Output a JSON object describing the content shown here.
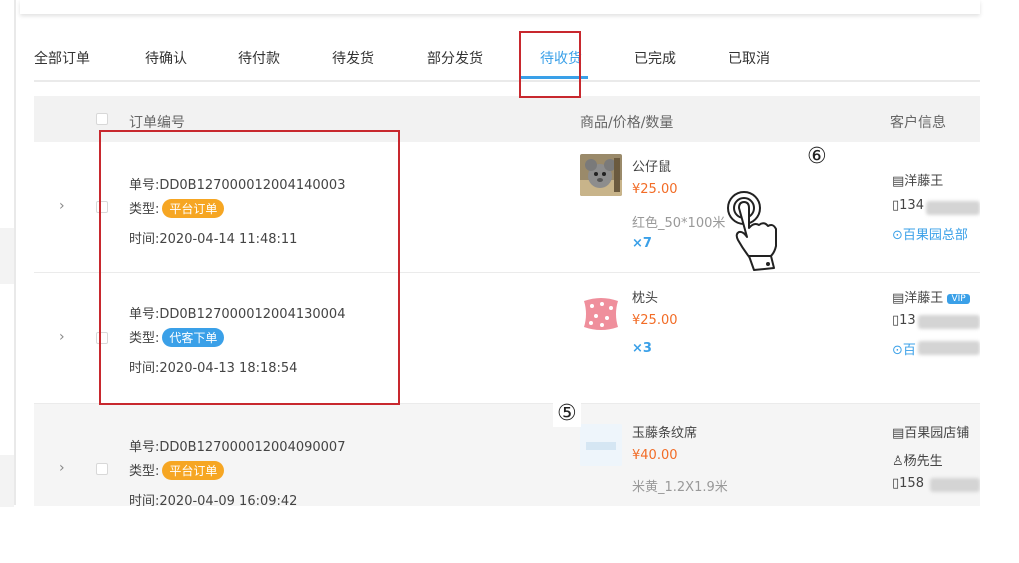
{
  "tabs": [
    {
      "label": "全部订单"
    },
    {
      "label": "待确认"
    },
    {
      "label": "待付款"
    },
    {
      "label": "待发货"
    },
    {
      "label": "部分发货"
    },
    {
      "label": "待收货"
    },
    {
      "label": "已完成"
    },
    {
      "label": "已取消"
    }
  ],
  "active_tab": "待收货",
  "columns": {
    "order_no": "订单编号",
    "product": "商品/价格/数量",
    "customer": "客户信息"
  },
  "orders": [
    {
      "number": "单号:DD0B127000012004140003",
      "type_label": "类型:",
      "type_badge": "平台订单",
      "time": "时间:2020-04-14 11:48:11",
      "product_name": "公仔鼠",
      "price": "¥25.00",
      "spec": "红色_50*100米",
      "qty": "×7",
      "customer_name": "洋藤王",
      "customer_phone": "134",
      "customer_store": "百果园总部"
    },
    {
      "number": "单号:DD0B127000012004130004",
      "type_label": "类型:",
      "type_badge": "代客下单",
      "time": "时间:2020-04-13 18:18:54",
      "product_name": "枕头",
      "price": "¥25.00",
      "qty": "×3",
      "customer_name": "洋藤王",
      "customer_vip": "VIP",
      "customer_phone": "13",
      "customer_store": "百"
    },
    {
      "number": "单号:DD0B127000012004090007",
      "type_label": "类型:",
      "type_badge": "平台订单",
      "time": "时间:2020-04-09 16:09:42",
      "product_name": "玉藤条纹席",
      "price": "¥40.00",
      "spec": "米黄_1.2X1.9米",
      "customer_name": "百果园店铺",
      "customer_contact": "杨先生",
      "customer_phone": "158"
    }
  ],
  "annotations": {
    "marker_5": "⑤",
    "marker_6": "⑥"
  },
  "icons": {
    "store": "store-icon",
    "phone": "phone-icon",
    "location": "location-icon",
    "person": "person-icon",
    "hand": "hand-pointer-icon",
    "expand": "chevron-right-icon"
  },
  "colors": {
    "accent": "#3aa0e8",
    "price": "#f26c26",
    "badge_platform": "#f6a623",
    "badge_proxy": "#3aa0e8",
    "highlight": "#c8282e"
  }
}
